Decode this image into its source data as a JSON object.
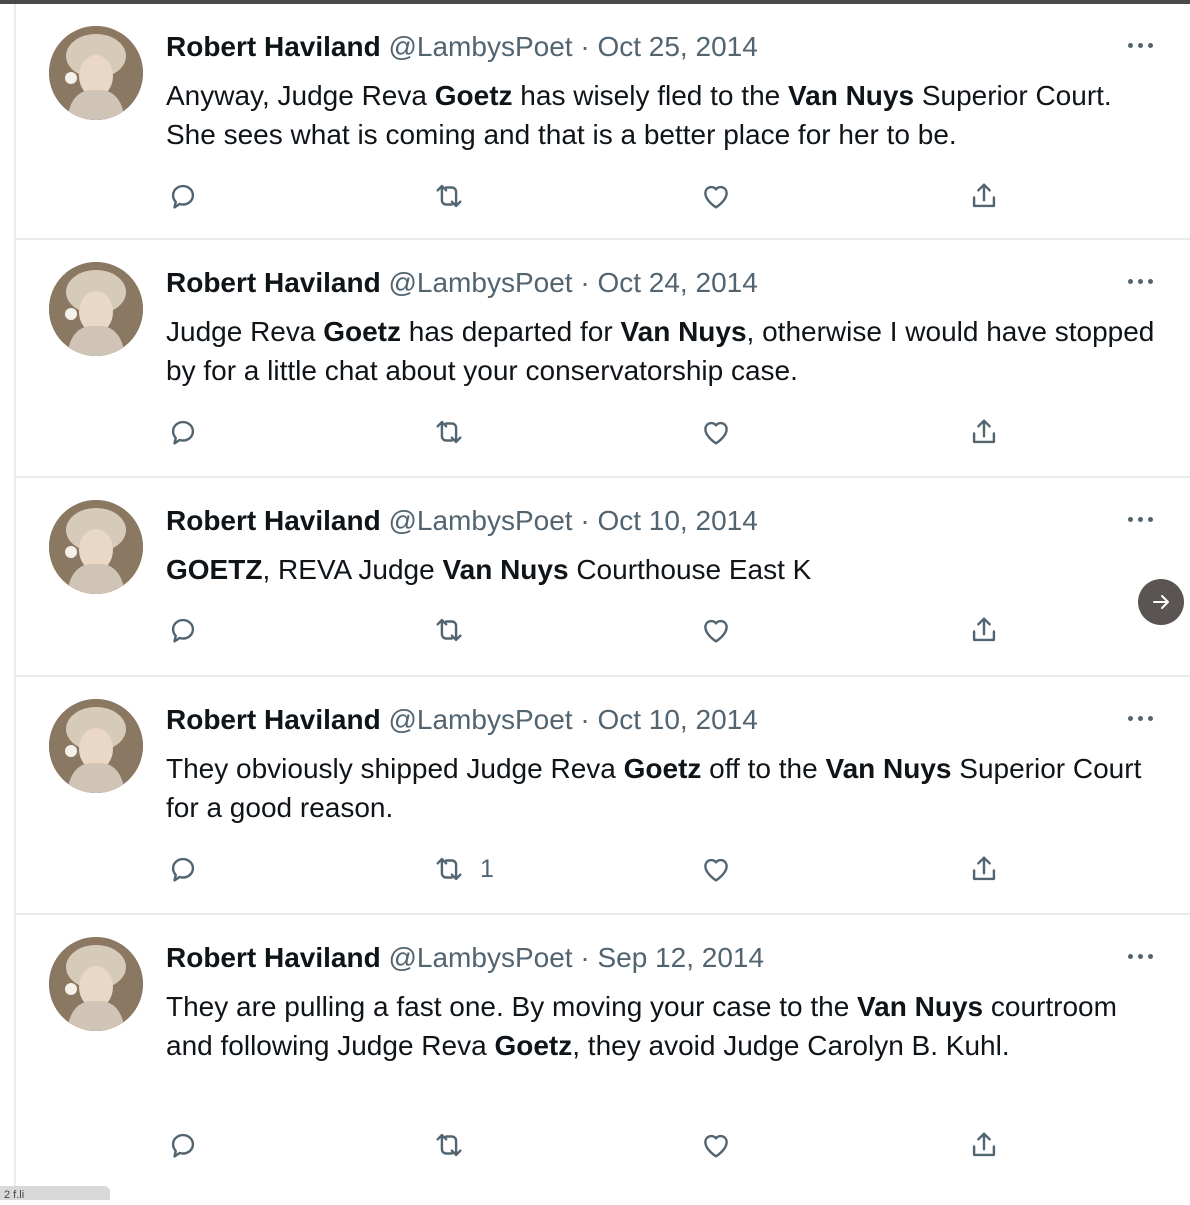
{
  "tweets": [
    {
      "name": "Robert Haviland",
      "handle": "@LambysPoet",
      "separator": "·",
      "date": "Oct 25, 2014",
      "text_parts": [
        {
          "t": "Anyway, Judge Reva ",
          "b": false
        },
        {
          "t": "Goetz",
          "b": true
        },
        {
          "t": " has wisely fled to the ",
          "b": false
        },
        {
          "t": "Van Nuys",
          "b": true
        },
        {
          "t": " Superior Court. She sees what is coming and that is a better place for her to be.",
          "b": false
        }
      ],
      "retweet_count": ""
    },
    {
      "name": "Robert Haviland",
      "handle": "@LambysPoet",
      "separator": "·",
      "date": "Oct 24, 2014",
      "text_parts": [
        {
          "t": "Judge Reva ",
          "b": false
        },
        {
          "t": "Goetz",
          "b": true
        },
        {
          "t": " has departed for ",
          "b": false
        },
        {
          "t": "Van Nuys",
          "b": true
        },
        {
          "t": ", otherwise I would have stopped by for a little chat about your conservatorship case.",
          "b": false
        }
      ],
      "retweet_count": ""
    },
    {
      "name": "Robert Haviland",
      "handle": "@LambysPoet",
      "separator": "·",
      "date": "Oct 10, 2014",
      "text_parts": [
        {
          "t": "GOETZ",
          "b": true
        },
        {
          "t": ", REVA Judge ",
          "b": false
        },
        {
          "t": "Van Nuys",
          "b": true
        },
        {
          "t": " Courthouse East K",
          "b": false
        }
      ],
      "retweet_count": ""
    },
    {
      "name": "Robert Haviland",
      "handle": "@LambysPoet",
      "separator": "·",
      "date": "Oct 10, 2014",
      "text_parts": [
        {
          "t": "They obviously shipped Judge Reva ",
          "b": false
        },
        {
          "t": "Goetz",
          "b": true
        },
        {
          "t": " off to the ",
          "b": false
        },
        {
          "t": "Van Nuys",
          "b": true
        },
        {
          "t": " Superior Court for a good reason.",
          "b": false
        }
      ],
      "retweet_count": "1"
    },
    {
      "name": "Robert Haviland",
      "handle": "@LambysPoet",
      "separator": "·",
      "date": "Sep 12, 2014",
      "text_parts": [
        {
          "t": "They are pulling a fast one. By moving your case to the ",
          "b": false
        },
        {
          "t": "Van Nuys",
          "b": true
        },
        {
          "t": " courtroom and following Judge Reva ",
          "b": false
        },
        {
          "t": "Goetz",
          "b": true
        },
        {
          "t": ", they avoid Judge Carolyn B. Kuhl.",
          "b": false
        }
      ],
      "retweet_count": ""
    }
  ],
  "icons": {
    "reply": "reply-icon",
    "retweet": "retweet-icon",
    "like": "like-icon",
    "share": "share-icon",
    "more": "more-icon",
    "next": "arrow-right-icon"
  },
  "colors": {
    "text": "#0f1419",
    "muted": "#536471",
    "divider": "#e6ecf0",
    "nav_button": "#5a5452"
  },
  "bottom_strip_text": "2 f.li"
}
